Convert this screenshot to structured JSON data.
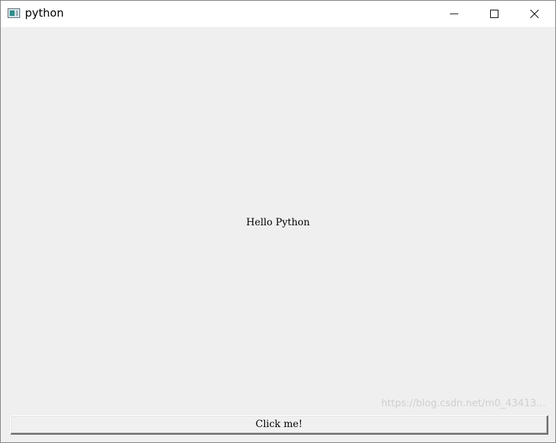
{
  "window": {
    "title": "python",
    "icon": "python-app-icon",
    "controls": {
      "minimize_icon": "minimize-icon",
      "maximize_icon": "maximize-icon",
      "close_icon": "close-icon"
    }
  },
  "content": {
    "label_text": "Hello Python",
    "button_label": "Click me!"
  },
  "watermark": {
    "text": "https://blog.csdn.net/m0_43413..."
  },
  "colors": {
    "titlebar_bg": "#ffffff",
    "client_bg": "#efefef",
    "text": "#000000"
  }
}
